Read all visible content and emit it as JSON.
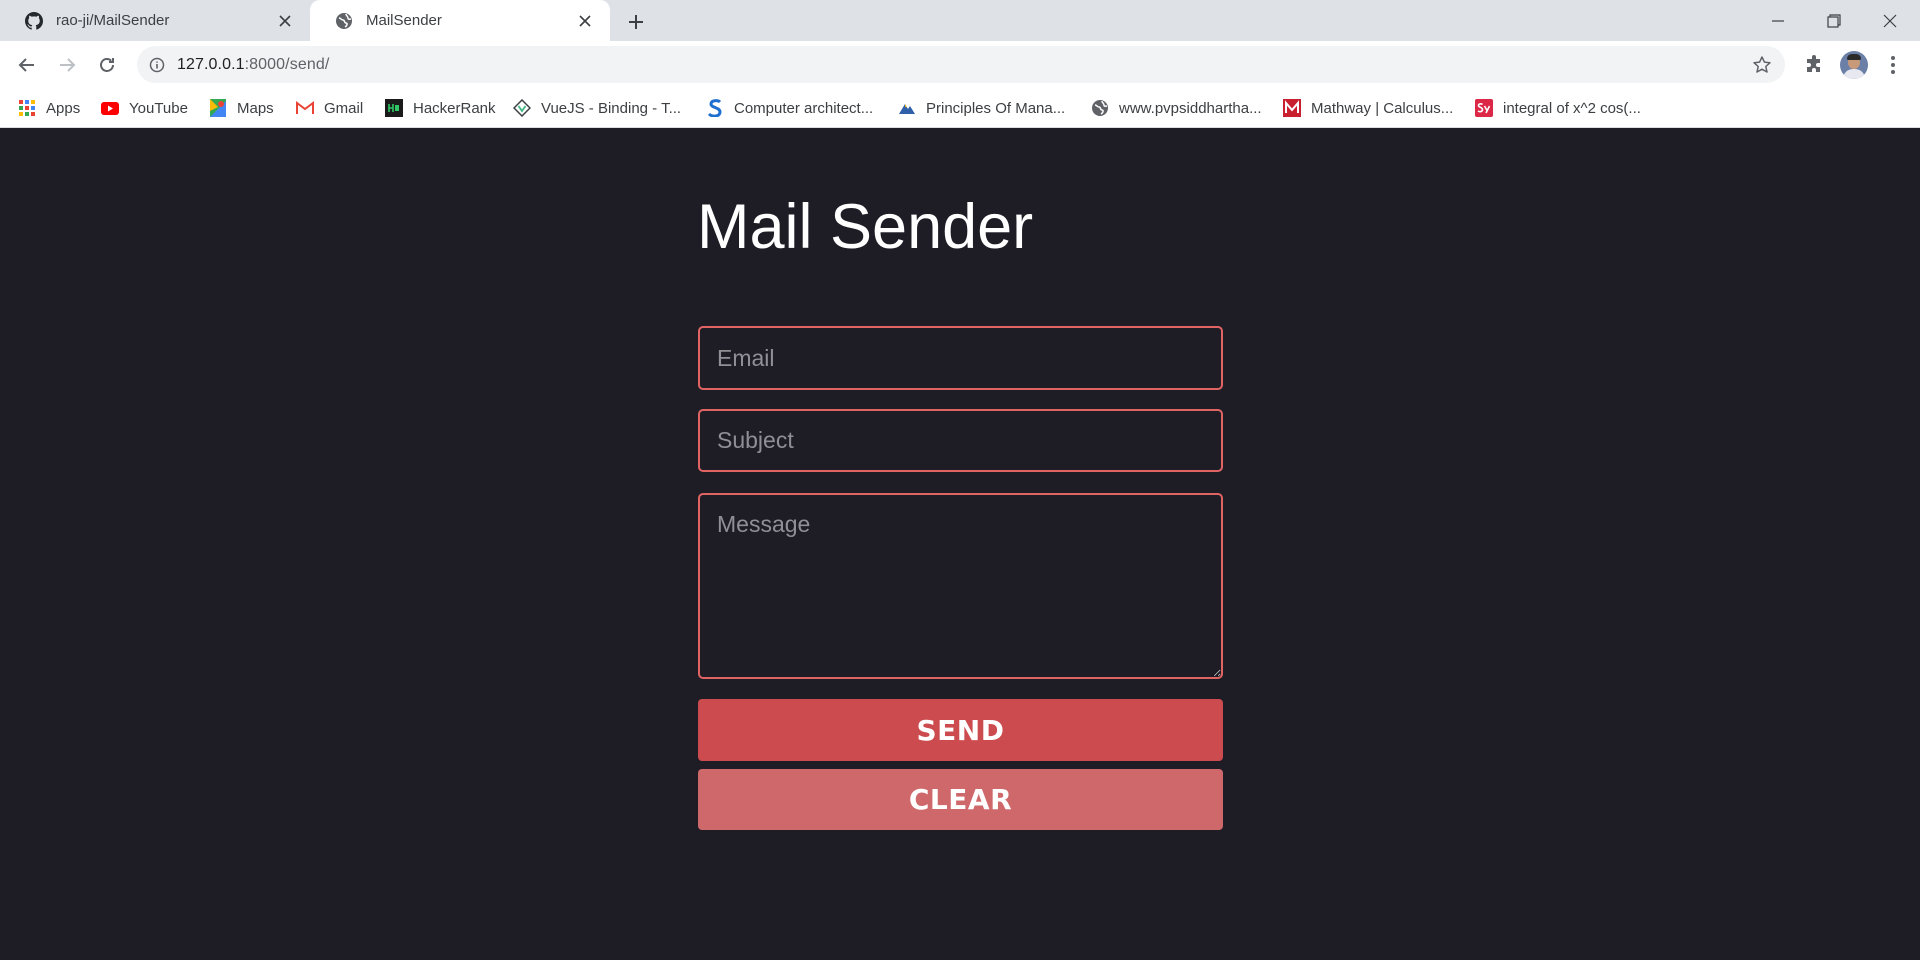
{
  "browser": {
    "tabs": [
      {
        "label": "rao-ji/MailSender",
        "favicon": "github-icon",
        "active": false
      },
      {
        "label": "MailSender",
        "favicon": "globe-icon",
        "active": true
      }
    ],
    "url_host": "127.0.0.1",
    "url_path": ":8000/send/",
    "bookmarks": [
      {
        "label": "Apps",
        "icon": "apps-grid-icon"
      },
      {
        "label": "YouTube",
        "icon": "youtube-icon"
      },
      {
        "label": "Maps",
        "icon": "maps-icon"
      },
      {
        "label": "Gmail",
        "icon": "gmail-icon"
      },
      {
        "label": "HackerRank",
        "icon": "hackerrank-icon"
      },
      {
        "label": "VueJS - Binding - T...",
        "icon": "vuejs-icon"
      },
      {
        "label": "Computer architect...",
        "icon": "s-logo-icon"
      },
      {
        "label": "Principles Of Mana...",
        "icon": "mountain-icon"
      },
      {
        "label": "www.pvpsiddhartha...",
        "icon": "globe-icon"
      },
      {
        "label": "Mathway | Calculus...",
        "icon": "mathway-icon"
      },
      {
        "label": "integral of x^2 cos(...",
        "icon": "symbolab-icon"
      }
    ]
  },
  "form": {
    "title": "Mail Sender",
    "email_placeholder": "Email",
    "subject_placeholder": "Subject",
    "message_placeholder": "Message",
    "send_label": "SEND",
    "clear_label": "CLEAR"
  },
  "colors": {
    "page_background": "#1e1d26",
    "field_border": "#e06464",
    "send_button": "#cb4b4e",
    "clear_button": "#cf686a"
  }
}
